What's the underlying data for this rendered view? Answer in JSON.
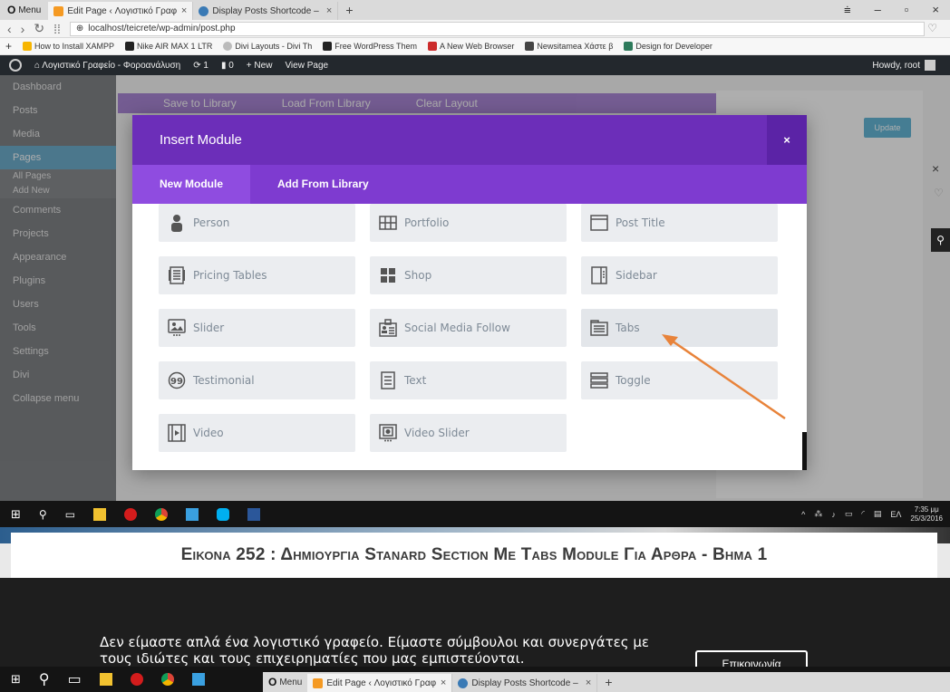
{
  "browser": {
    "menu_label": "Menu",
    "tabs": [
      {
        "title": "Edit Page ‹ Λογιστικό Γραφ",
        "active": true
      },
      {
        "title": "Display Posts Shortcode – ",
        "active": false
      }
    ],
    "url": "localhost/teicrete/wp-admin/post.php",
    "bookmarks": [
      {
        "label": "How to Install XAMPP",
        "color": "#f7b500"
      },
      {
        "label": "Nike AIR MAX 1 LTR ",
        "color": "#222222"
      },
      {
        "label": "Divi Layouts - Divi Th",
        "color": "#bbbbbb"
      },
      {
        "label": "Free WordPress Them",
        "color": "#222222"
      },
      {
        "label": "A New Web Browser",
        "color": "#cc2b2b"
      },
      {
        "label": "Newsitamea Χάστε β",
        "color": "#444444"
      },
      {
        "label": "Design for Developer",
        "color": "#2d7a5b"
      }
    ]
  },
  "adminbar": {
    "site": "Λογιστικό Γραφείο - Φοροανάλυση",
    "updates": "1",
    "comments": "0",
    "new": "New",
    "view": "View Page",
    "howdy": "Howdy, root"
  },
  "sidebar": {
    "items": [
      "Dashboard",
      "Posts",
      "Media",
      "Pages",
      "All Pages",
      "Add New",
      "Comments",
      "Projects",
      "Appearance",
      "Plugins",
      "Users",
      "Tools",
      "Settings",
      "Divi",
      "Collapse menu"
    ]
  },
  "builder": {
    "save_library": "Save to Library",
    "load_library": "Load From Library",
    "clear_layout": "Clear Layout",
    "update": "Update"
  },
  "modal": {
    "title": "Insert Module",
    "close": "×",
    "tabs": [
      "New Module",
      "Add From Library"
    ],
    "modules": [
      {
        "label": "Person",
        "icon": "person-icon"
      },
      {
        "label": "Portfolio",
        "icon": "portfolio-icon"
      },
      {
        "label": "Post Title",
        "icon": "post-title-icon"
      },
      {
        "label": "Pricing Tables",
        "icon": "pricing-tables-icon"
      },
      {
        "label": "Shop",
        "icon": "shop-icon"
      },
      {
        "label": "Sidebar",
        "icon": "sidebar-icon"
      },
      {
        "label": "Slider",
        "icon": "slider-icon"
      },
      {
        "label": "Social Media Follow",
        "icon": "social-follow-icon"
      },
      {
        "label": "Tabs",
        "icon": "tabs-icon"
      },
      {
        "label": "Testimonial",
        "icon": "testimonial-icon"
      },
      {
        "label": "Text",
        "icon": "text-icon"
      },
      {
        "label": "Toggle",
        "icon": "toggle-icon"
      },
      {
        "label": "Video",
        "icon": "video-icon"
      },
      {
        "label": "Video Slider",
        "icon": "video-slider-icon"
      }
    ],
    "highlight": "Tabs"
  },
  "taskbar": {
    "clock_time": "7:35 μμ",
    "clock_date": "25/3/2016",
    "lang": "ΕΛ"
  },
  "document": {
    "caption": "Εικονα 252 : Δημιουργια Stanard Section Με Tabs Module Για Αρθρα - Βημα 1",
    "hero_text": "Δεν είμαστε απλά ένα λογιστικό γραφείο. Είμαστε σύμβουλοι και συνεργάτες με τους ιδιώτες και τους επιχειρηματίες που μας εμπιστεύονται.",
    "hero_button": "Επικοινωνία"
  },
  "colors": {
    "divi_purple": "#6c2eb9",
    "divi_tab_purple": "#7e3bd0",
    "arrow": "#e8833a",
    "wp_dark": "#23282d"
  }
}
